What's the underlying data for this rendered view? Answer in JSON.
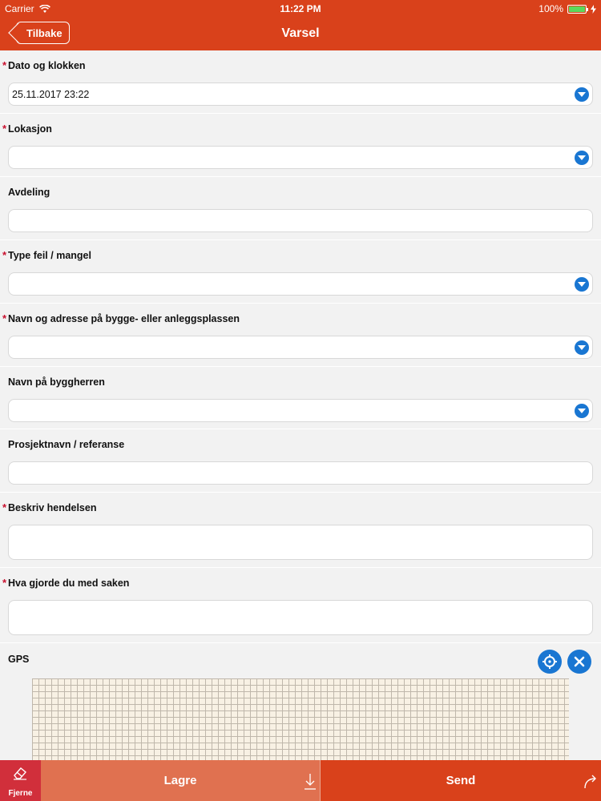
{
  "status_bar": {
    "carrier": "Carrier",
    "time": "11:22 PM",
    "battery": "100%",
    "battery_level": 1.0
  },
  "nav": {
    "back_label": "Tilbake",
    "title": "Varsel"
  },
  "fields": [
    {
      "label": "Dato og klokken",
      "required": true,
      "type": "dropdown",
      "value": "25.11.2017 23:22"
    },
    {
      "label": "Lokasjon",
      "required": true,
      "type": "dropdown",
      "value": ""
    },
    {
      "label": "Avdeling",
      "required": false,
      "type": "text",
      "value": ""
    },
    {
      "label": "Type feil / mangel",
      "required": true,
      "type": "dropdown",
      "value": ""
    },
    {
      "label": "Navn og adresse på bygge- eller anleggsplassen",
      "required": true,
      "type": "dropdown",
      "value": ""
    },
    {
      "label": "Navn på byggherren",
      "required": false,
      "type": "dropdown",
      "value": ""
    },
    {
      "label": "Prosjektnavn / referanse",
      "required": false,
      "type": "text",
      "value": ""
    },
    {
      "label": "Beskriv hendelsen",
      "required": true,
      "type": "textarea",
      "value": ""
    },
    {
      "label": "Hva gjorde du med saken",
      "required": true,
      "type": "textarea",
      "value": ""
    }
  ],
  "required_marker": "*",
  "gps": {
    "label": "GPS",
    "locate_icon": "crosshair-icon",
    "clear_icon": "close-icon"
  },
  "bottom_bar": {
    "remove_label": "Fjerne",
    "save_label": "Lagre",
    "send_label": "Send"
  },
  "colors": {
    "accent": "#d9411b",
    "save": "#e07150",
    "remove": "#d12f3b",
    "icon_blue": "#1976d2",
    "required": "#c8102e"
  }
}
